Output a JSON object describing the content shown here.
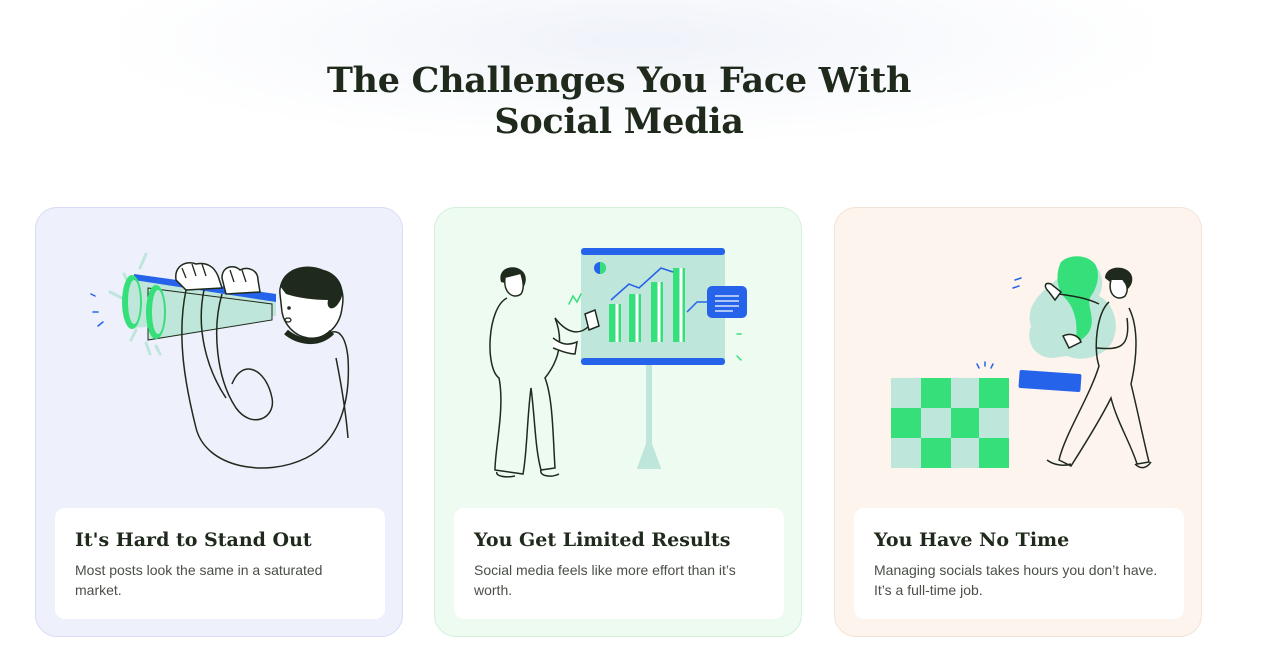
{
  "section": {
    "title_line1": "The Challenges You Face With",
    "title_line2": "Social Media"
  },
  "colors": {
    "heading": "#1f2a1c",
    "green": "#35e07a",
    "mint": "#bfe6da",
    "blue": "#2563eb"
  },
  "cards": [
    {
      "illustration": "binoculars-person-icon",
      "title": "It's Hard to Stand Out",
      "description": "Most posts look the same in a saturated market."
    },
    {
      "illustration": "presentation-chart-icon",
      "title": "You Get Limited Results",
      "description": "Social media feels like more effort than it’s worth."
    },
    {
      "illustration": "person-carrying-statue-icon",
      "title": "You Have No Time",
      "description": "Managing socials takes hours you don’t have. It’s a full-time job."
    }
  ]
}
